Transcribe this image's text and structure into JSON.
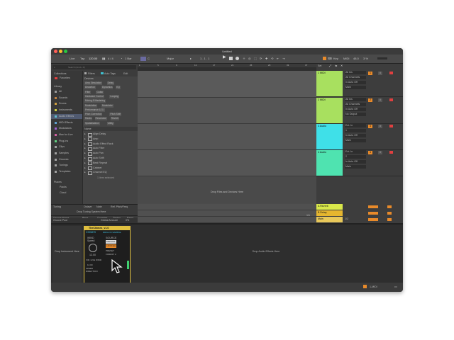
{
  "app": {
    "title": "Untitled"
  },
  "toolbar": {
    "link": "Live",
    "tap": "Tap",
    "tempo": "120.00",
    "time_sig": "4 / 4",
    "quant": "1 Bar",
    "key_root": "C",
    "scale": "Major",
    "position": "1 . 1 . 1",
    "key_label": "Key",
    "midi_label": "MIDI",
    "cpu": "48.0",
    "cpu_pct": "3 %"
  },
  "browser": {
    "search_placeholder": "Search (Cmd + F)",
    "filters_label": "Filters",
    "autotags_label": "Auto Tags",
    "edit_label": "Edit",
    "collections_header": "Collections",
    "favorites": "Favorites",
    "library_header": "Library",
    "library_items": [
      "All",
      "Sounds",
      "Drums",
      "Instruments",
      "Audio Effects",
      "MIDI Effects",
      "Modulators",
      "Max for Live",
      "Plug-Ins",
      "Clips",
      "Samples",
      "Grooves",
      "Tunings",
      "Templates"
    ],
    "places_header": "Places",
    "places_items": [
      "Packs",
      "Cloud"
    ],
    "devices_header": "Devices",
    "tag_rows": [
      [
        "Amp Simulation",
        "Delay"
      ],
      [
        "Distortion",
        "Dynamics",
        "EQ"
      ],
      [
        "Filter",
        "Guitar"
      ],
      [
        "Hardware Control",
        "Looping"
      ],
      [
        "Mixing & Mastering"
      ],
      [
        "Modulation",
        "Modulator"
      ],
      [
        "Performance & DJ"
      ],
      [
        "Pitch Correction",
        "Pitch Shift"
      ],
      [
        "Racks",
        "Resonator",
        "Reverb"
      ],
      [
        "Spatialization",
        "Utility"
      ]
    ],
    "name_header": "Name",
    "devices": [
      "Align Delay",
      "Amp",
      "Audio Effect Rack",
      "Auto Filter",
      "Auto Pan",
      "Auto Shift",
      "Beat Repeat",
      "Cabinet",
      "Channel EQ"
    ],
    "selected_info": "1 item selected"
  },
  "tuning": {
    "header": "Tuning",
    "cols": [
      "Octave",
      "Note",
      "Ref. Pitch/Freq"
    ],
    "drop_text": "Drop Tuning System Here"
  },
  "groove": {
    "cols": [
      "Groove Name",
      "Base",
      "Quantize",
      "Timing",
      "Rand"
    ],
    "row": [
      "Swing",
      "1/16",
      "0 %",
      "100 %",
      ""
    ],
    "global_label": "Global Amount",
    "global_value": "0%",
    "pool_label": "Groove Pool"
  },
  "arrangement": {
    "ruler": [
      "1",
      "5",
      "9",
      "13",
      "17",
      "21",
      "25",
      "29",
      "33",
      "37"
    ],
    "drop_text": "Drop Files and Devices Here",
    "time_ruler": [
      "0:00",
      "0:10",
      "0:20",
      "0:30",
      "0:40",
      "0:50",
      "1:00",
      "1:10",
      "1:20",
      "1:30"
    ],
    "fraction": "1/1"
  },
  "session": {
    "set_label": "Set",
    "tracks": [
      {
        "name": "1 MIDI",
        "color": "#a8e05f",
        "io": [
          "All Ins",
          "All Channels",
          "In Auto Off",
          "Main"
        ],
        "num": "1",
        "vol": "0"
      },
      {
        "name": "2 MIDI",
        "color": "#a8e05f",
        "io": [
          "All Ins",
          "All Channels",
          "In Auto Off",
          "No Output"
        ],
        "num": "2",
        "vol": "0"
      },
      {
        "name": "3 Audio",
        "color": "#3fe0e8",
        "io": [
          "Ext. In",
          "1",
          "In Auto Off",
          "Main"
        ],
        "num": "3",
        "vol": "0"
      },
      {
        "name": "4 Audio",
        "color": "#4fe3b0",
        "io": [
          "Ext. In",
          "2",
          "In Auto Off",
          "Main"
        ],
        "num": "4",
        "vol": "0"
      }
    ],
    "returns": [
      {
        "name": "A Reverb",
        "color": "#d9e84a",
        "letter": "A"
      },
      {
        "name": "B Delay",
        "color": "#e6b62f",
        "letter": "B"
      },
      {
        "name": "Main",
        "color": "#e8c85a",
        "letter": ""
      }
    ],
    "main_value": "1/2",
    "main_extra": "0",
    "bottom": [
      "2 Bars",
      "M",
      "W"
    ]
  },
  "detail": {
    "device_title": "TheChimes_v1.0",
    "device_sub": "CHIMES",
    "device_tag": "DRAG IN SAMPLE",
    "knob_label_top": "WIND",
    "knob_label": "Speed",
    "knob_value": "12.00",
    "source_label": "SOURCE",
    "opt_manual": "MANUAL",
    "opt_lfo": "LFO/CHA",
    "preset_label": "PRESET",
    "preset_value": "FOREST 2",
    "bottom_row": "VIR. LIVE WIND",
    "bottom_value": "12.00",
    "speed_label": "SPEED",
    "direction_label": "DIRECTION",
    "drop_instrument": "Drop Instrument Here",
    "drop_effects": "Drop Audio Effects Here"
  },
  "status": {
    "track_label": "1-MIDI"
  }
}
